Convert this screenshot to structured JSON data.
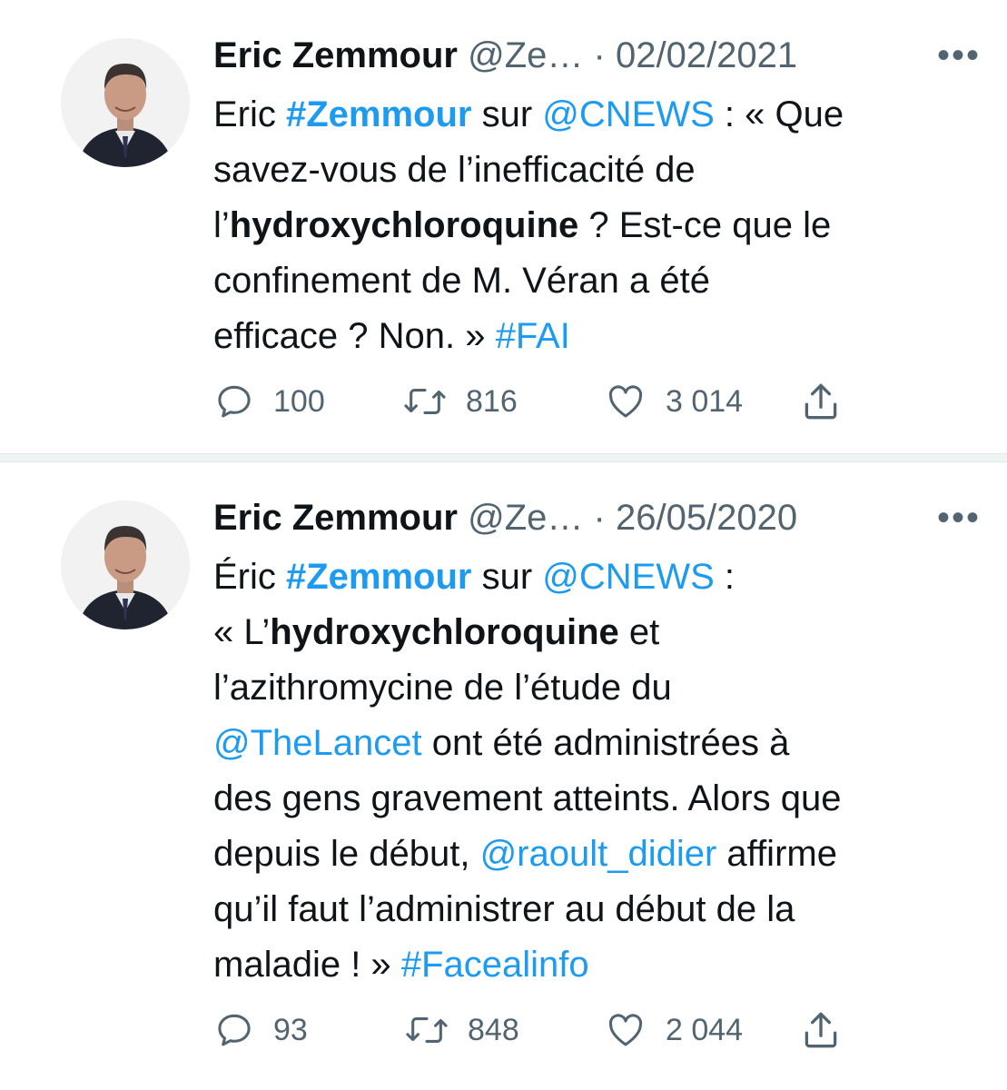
{
  "tweets": [
    {
      "author": {
        "name": "Eric Zemmour",
        "handle": "@Ze…",
        "avatar_icon": "avatar-photo-icon"
      },
      "dot": "·",
      "date": "02/02/2021",
      "more_icon": "•••",
      "text": [
        [
          {
            "t": "Eric "
          },
          {
            "t": "#Zemmour",
            "s": "tag-bold"
          },
          {
            "t": " sur "
          },
          {
            "t": "@CNEWS",
            "s": "link"
          },
          {
            "t": " : « Que"
          }
        ],
        [
          {
            "t": "savez-vous de l’inefficacité de"
          }
        ],
        [
          {
            "t": "l’"
          },
          {
            "t": "hydroxychloroquine",
            "s": "strong"
          },
          {
            "t": " ? Est-ce que le"
          }
        ],
        [
          {
            "t": "confinement de M. Véran a été"
          }
        ],
        [
          {
            "t": "efficace ? Non. » "
          },
          {
            "t": "#FAI",
            "s": "link"
          }
        ]
      ],
      "actions": {
        "replies": "100",
        "retweets": "816",
        "likes": "3 014"
      }
    },
    {
      "author": {
        "name": "Eric Zemmour",
        "handle": "@Ze…",
        "avatar_icon": "avatar-photo-icon"
      },
      "dot": "·",
      "date": "26/05/2020",
      "more_icon": "•••",
      "text": [
        [
          {
            "t": "Éric "
          },
          {
            "t": "#Zemmour",
            "s": "tag-bold"
          },
          {
            "t": " sur "
          },
          {
            "t": "@CNEWS",
            "s": "link"
          },
          {
            "t": " :"
          }
        ],
        [
          {
            "t": "« L’"
          },
          {
            "t": "hydroxychloroquine",
            "s": "strong"
          },
          {
            "t": " et"
          }
        ],
        [
          {
            "t": "l’azithromycine de l’étude du"
          }
        ],
        [
          {
            "t": "@TheLancet",
            "s": "link"
          },
          {
            "t": " ont été administrées à"
          }
        ],
        [
          {
            "t": "des gens gravement atteints. Alors que"
          }
        ],
        [
          {
            "t": "depuis le début, "
          },
          {
            "t": "@raoult_didier",
            "s": "link"
          },
          {
            "t": " affirme"
          }
        ],
        [
          {
            "t": "qu’il faut l’administrer au début de la"
          }
        ],
        [
          {
            "t": "maladie ! » "
          },
          {
            "t": "#Facealinfo",
            "s": "link"
          }
        ]
      ],
      "actions": {
        "replies": "93",
        "retweets": "848",
        "likes": "2 044"
      }
    }
  ],
  "colors": {
    "text": "#0f1419",
    "muted": "#536471",
    "link": "#1d9bf0",
    "separator": "#eff3f4"
  }
}
